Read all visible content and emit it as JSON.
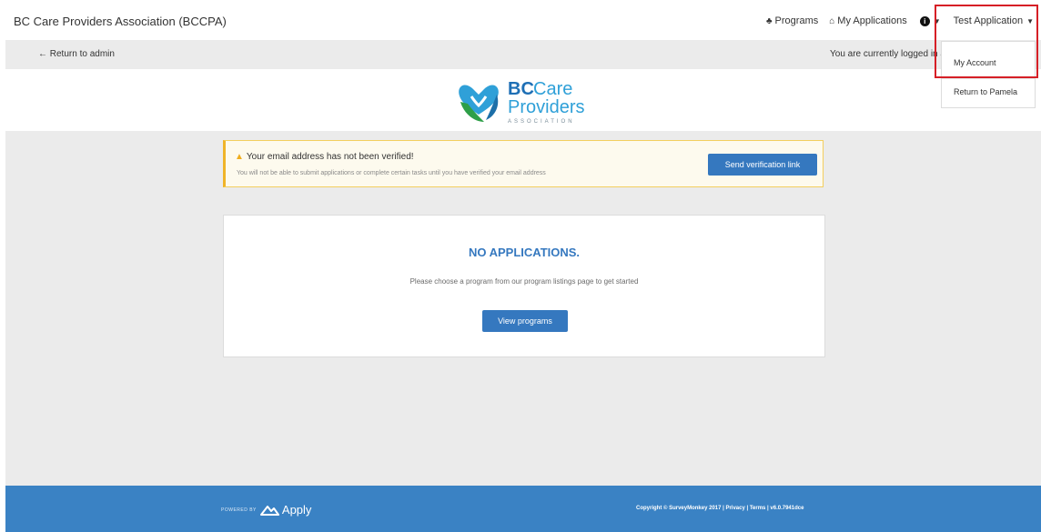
{
  "header": {
    "brand": "BC Care Providers Association (BCCPA)",
    "nav": {
      "programs": "Programs",
      "my_applications": "My Applications",
      "user_menu": "Test Application"
    }
  },
  "admin_bar": {
    "return_label": "← Return to admin",
    "logged_in_text": "You are currently logged in as"
  },
  "logo": {
    "line1a": "BC",
    "line1b": "Care",
    "line2": "Providers",
    "line3": "ASSOCIATION"
  },
  "alert": {
    "title": "Your email address has not been verified!",
    "description": "You will not be able to submit applications or complete certain tasks until you have verified your email address",
    "button": "Send verification link"
  },
  "empty_state": {
    "title": "NO APPLICATIONS.",
    "description": "Please choose a program from our program listings page to get started",
    "button": "View programs"
  },
  "footer": {
    "powered_by": "POWERED BY",
    "product": "Apply",
    "copyright": "Copyright © SurveyMonkey 2017 | Privacy | Terms | v6.0.7941dce"
  },
  "dropdown": {
    "items": [
      "My Account",
      "Return to Pamela"
    ]
  },
  "colors": {
    "primary": "#3578bf",
    "footer": "#3a82c4",
    "warning_border": "#f0b429",
    "highlight": "#d61f26"
  }
}
